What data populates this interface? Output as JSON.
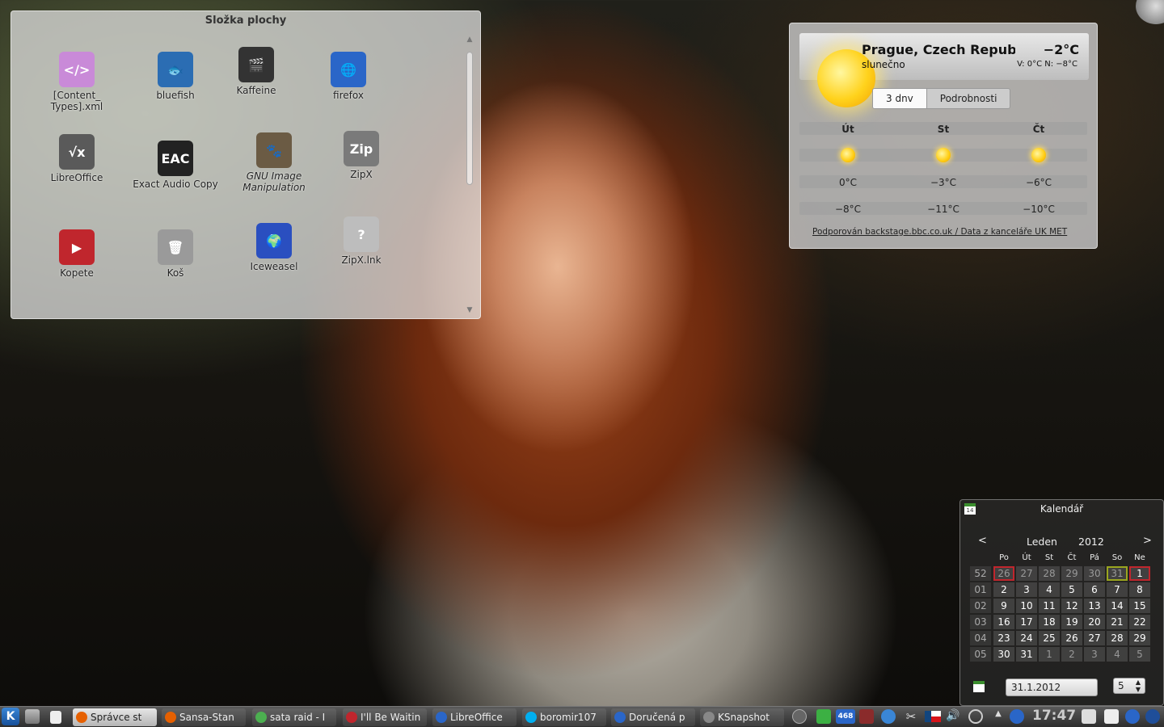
{
  "folder": {
    "title": "Složka plochy",
    "icons": [
      {
        "label": "[Content_\nTypes].xml",
        "glyph": "</>",
        "color": "#c98ad8"
      },
      {
        "label": "bluefish",
        "glyph": "🐟",
        "color": "#2b6db3"
      },
      {
        "label": "Kaffeine",
        "glyph": "🎬",
        "color": "#333333"
      },
      {
        "label": "firefox",
        "glyph": "🌐",
        "color": "#2a66c8"
      },
      {
        "label": "LibreOffice",
        "glyph": "√x",
        "color": "#5a5a5a"
      },
      {
        "label": "Exact Audio Copy",
        "glyph": "EAC",
        "color": "#222222"
      },
      {
        "label": "GNU Image Manipulation",
        "glyph": "🐾",
        "color": "#6b5b44"
      },
      {
        "label": "ZipX",
        "glyph": "Zip",
        "color": "#7a7a7a"
      },
      {
        "label": "Kopete",
        "glyph": "▶",
        "color": "#c0262d"
      },
      {
        "label": "Koš",
        "glyph": "🗑",
        "color": "#9a9a9a"
      },
      {
        "label": "Iceweasel",
        "glyph": "🌍",
        "color": "#2a4fc0"
      },
      {
        "label": "ZipX.lnk",
        "glyph": "?",
        "color": "#bdbdbd"
      }
    ]
  },
  "weather": {
    "location": "Prague, Czech Republic",
    "condition": "slunečno",
    "temperature": "−2°C",
    "high_low": "V: 0°C N: −8°C",
    "tabs": [
      "3 dnv",
      "Podrobnosti"
    ],
    "days": [
      {
        "name": "Út",
        "high": "0°C",
        "low": "−8°C"
      },
      {
        "name": "St",
        "high": "−3°C",
        "low": "−11°C"
      },
      {
        "name": "Čt",
        "high": "−6°C",
        "low": "−10°C"
      }
    ],
    "credit": "Podporován backstage.bbc.co.uk / Data z kanceláře UK MET"
  },
  "calendar": {
    "title": "Kalendář",
    "icon_day": "14",
    "prev": "<",
    "next": ">",
    "month": "Leden",
    "year": "2012",
    "weekdays": [
      "Po",
      "Út",
      "St",
      "Čt",
      "Pá",
      "So",
      "Ne"
    ],
    "weeks": [
      {
        "num": "52",
        "days": [
          "26",
          "27",
          "28",
          "29",
          "30",
          "31",
          "1"
        ]
      },
      {
        "num": "01",
        "days": [
          "2",
          "3",
          "4",
          "5",
          "6",
          "7",
          "8"
        ]
      },
      {
        "num": "02",
        "days": [
          "9",
          "10",
          "11",
          "12",
          "13",
          "14",
          "15"
        ]
      },
      {
        "num": "03",
        "days": [
          "16",
          "17",
          "18",
          "19",
          "20",
          "21",
          "22"
        ]
      },
      {
        "num": "04",
        "days": [
          "23",
          "24",
          "25",
          "26",
          "27",
          "28",
          "29"
        ]
      },
      {
        "num": "05",
        "days": [
          "30",
          "31",
          "1",
          "2",
          "3",
          "4",
          "5"
        ]
      }
    ],
    "date_value": "31.1.2012",
    "week_value": "5"
  },
  "taskbar": {
    "kicker": "K",
    "tasks": [
      {
        "label": "Správce st",
        "color": "#e66000",
        "active": true
      },
      {
        "label": "Sansa-Stan",
        "color": "#e66000",
        "active": false
      },
      {
        "label": "sata raid - I",
        "color": "#4caf50",
        "active": false
      },
      {
        "label": "I'll Be Waitin",
        "color": "#c0262d",
        "active": false
      },
      {
        "label": "LibreOffice",
        "color": "#2a66c8",
        "active": false
      },
      {
        "label": "boromir107",
        "color": "#00aff0",
        "active": false
      },
      {
        "label": "Doručená p",
        "color": "#2a66c8",
        "active": false
      },
      {
        "label": "KSnapshot",
        "color": "#888888",
        "active": false
      }
    ],
    "clock": "17:47",
    "tray_badge": "468"
  }
}
